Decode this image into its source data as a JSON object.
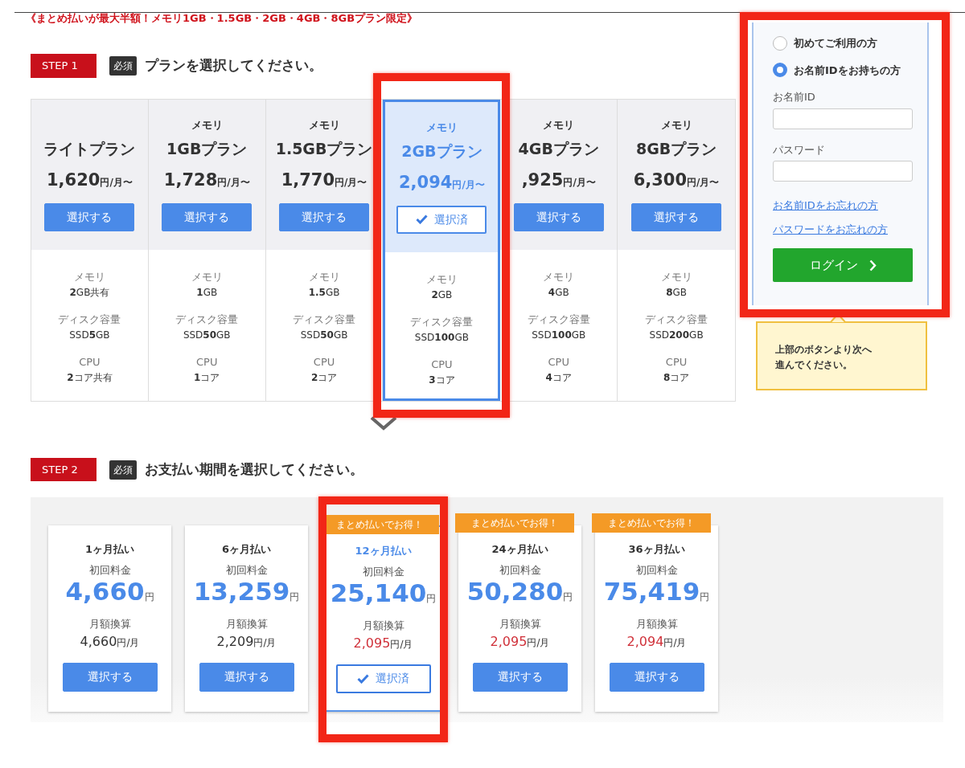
{
  "promo_banner": "《まとめ払いが最大半額！メモリ1GB・1.5GB・2GB・4GB・8GBプラン限定》",
  "step1": {
    "step": "STEP 1",
    "required": "必須",
    "heading": "プランを選択してください。"
  },
  "plans": [
    {
      "name": "ライトプラン",
      "price_amount": "1,620",
      "price_unit": "円/月〜",
      "button": "選択する",
      "selected": false,
      "highlighted": false,
      "specs": [
        {
          "label": "メモリ",
          "value": "**2**GB共有"
        },
        {
          "label": "ディスク容量",
          "value": "SSD**5**GB"
        },
        {
          "label": "CPU",
          "value": "**2**コア共有"
        }
      ]
    },
    {
      "kicker": "メモリ",
      "name": "1GBプラン",
      "price_amount": "1,728",
      "price_unit": "円/月〜",
      "button": "選択する",
      "selected": false,
      "highlighted": false,
      "specs": [
        {
          "label": "メモリ",
          "value": "**1**GB"
        },
        {
          "label": "ディスク容量",
          "value": "SSD**50**GB"
        },
        {
          "label": "CPU",
          "value": "**1**コア"
        }
      ]
    },
    {
      "kicker": "メモリ",
      "name": "1.5GBプラン",
      "price_amount": "1,770",
      "price_unit": "円/月〜",
      "button": "選択する",
      "selected": false,
      "highlighted": false,
      "specs": [
        {
          "label": "メモリ",
          "value": "**1.5**GB"
        },
        {
          "label": "ディスク容量",
          "value": "SSD**50**GB"
        },
        {
          "label": "CPU",
          "value": "**2**コア"
        }
      ]
    },
    {
      "kicker": "メモリ",
      "name": "2GBプラン",
      "price_amount": "2,094",
      "price_unit": "円/月〜",
      "button": "選択済",
      "selected": true,
      "highlighted": true,
      "specs": [
        {
          "label": "メモリ",
          "value": "**2**GB"
        },
        {
          "label": "ディスク容量",
          "value": "SSD**100**GB"
        },
        {
          "label": "CPU",
          "value": "**3**コア"
        }
      ]
    },
    {
      "kicker": "メモリ",
      "name": "4GBプラン",
      "price_amount": ",925",
      "price_unit": "円/月〜",
      "button": "選択する",
      "selected": false,
      "highlighted": false,
      "specs": [
        {
          "label": "メモリ",
          "value": "**4**GB"
        },
        {
          "label": "ディスク容量",
          "value": "SSD**100**GB"
        },
        {
          "label": "CPU",
          "value": "**4**コア"
        }
      ]
    },
    {
      "kicker": "メモリ",
      "name": "8GBプラン",
      "price_amount": "6,300",
      "price_unit": "円/月〜",
      "button": "選択する",
      "selected": false,
      "highlighted": false,
      "specs": [
        {
          "label": "メモリ",
          "value": "**8**GB"
        },
        {
          "label": "ディスク容量",
          "value": "SSD**200**GB"
        },
        {
          "label": "CPU",
          "value": "**8**コア"
        }
      ]
    }
  ],
  "login": {
    "highlighted": true,
    "options": [
      {
        "label": "初めてご利用の方",
        "selected": false
      },
      {
        "label": "お名前IDをお持ちの方",
        "selected": true
      }
    ],
    "fields": [
      {
        "label": "お名前ID"
      },
      {
        "label": "パスワード"
      }
    ],
    "links": [
      "お名前IDをお忘れの方",
      "パスワードをお忘れの方"
    ],
    "button": "ログイン"
  },
  "hint": [
    "上部のボタンより次へ",
    "進んでください。"
  ],
  "step2": {
    "step": "STEP 2",
    "required": "必須",
    "heading": "お支払い期間を選択してください。"
  },
  "periods": [
    {
      "name": "1ヶ月払い",
      "initial_label": "初回料金",
      "initial_amount": "4,660",
      "initial_unit": "円",
      "monthly_label": "月額換算",
      "monthly_amount": "4,660",
      "monthly_unit": "円/月",
      "discounted": false,
      "button": "選択する",
      "selected": false,
      "highlighted": false
    },
    {
      "name": "6ヶ月払い",
      "initial_label": "初回料金",
      "initial_amount": "13,259",
      "initial_unit": "円",
      "monthly_label": "月額換算",
      "monthly_amount": "2,209",
      "monthly_unit": "円/月",
      "discounted": false,
      "button": "選択する",
      "selected": false,
      "highlighted": false
    },
    {
      "tag": "まとめ払いでお得！",
      "name": "12ヶ月払い",
      "initial_label": "初回料金",
      "initial_amount": "25,140",
      "initial_unit": "円",
      "monthly_label": "月額換算",
      "monthly_amount": "2,095",
      "monthly_unit": "円/月",
      "discounted": true,
      "button": "選択済",
      "selected": true,
      "highlighted": true
    },
    {
      "tag": "まとめ払いでお得！",
      "name": "24ヶ月払い",
      "initial_label": "初回料金",
      "initial_amount": "50,280",
      "initial_unit": "円",
      "monthly_label": "月額換算",
      "monthly_amount": "2,095",
      "monthly_unit": "円/月",
      "discounted": true,
      "button": "選択する",
      "selected": false,
      "highlighted": false
    },
    {
      "tag": "まとめ払いでお得！",
      "name": "36ヶ月払い",
      "initial_label": "初回料金",
      "initial_amount": "75,419",
      "initial_unit": "円",
      "monthly_label": "月額換算",
      "monthly_amount": "2,094",
      "monthly_unit": "円/月",
      "discounted": true,
      "button": "選択する",
      "selected": false,
      "highlighted": false
    }
  ]
}
